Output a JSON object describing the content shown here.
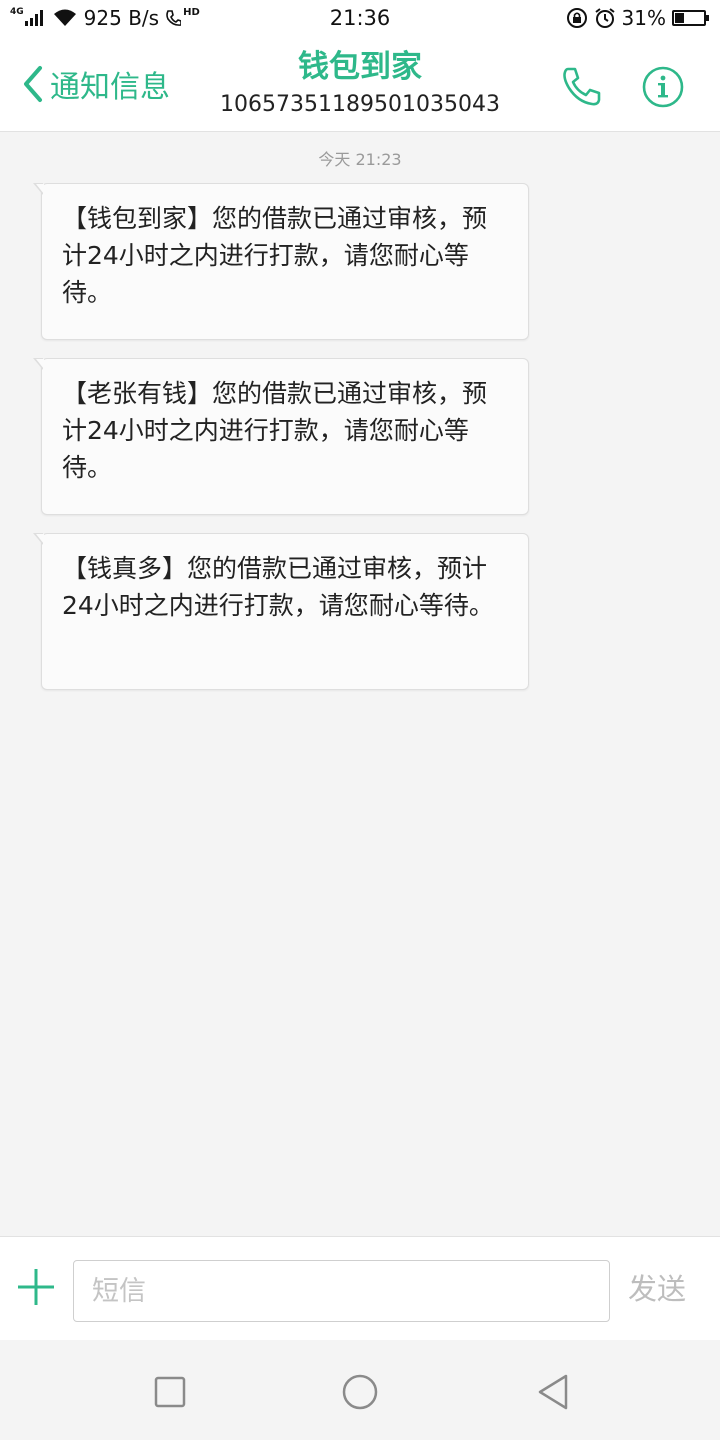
{
  "status_bar": {
    "network": "4G",
    "speed": "925 B/s",
    "hd": "HD",
    "time": "21:36",
    "battery_percent": "31%",
    "battery_level": 0.31
  },
  "header": {
    "back_label": "通知信息",
    "title": "钱包到家",
    "number": "10657351189501035043"
  },
  "conversation": {
    "timestamp": "今天 21:23",
    "messages": [
      "【钱包到家】您的借款已通过审核，预计24小时之内进行打款，请您耐心等待。",
      "【老张有钱】您的借款已通过审核，预计24小时之内进行打款，请您耐心等待。",
      "【钱真多】您的借款已通过审核，预计24小时之内进行打款，请您耐心等待。"
    ]
  },
  "composer": {
    "placeholder": "短信",
    "send_label": "发送"
  },
  "colors": {
    "accent": "#2eb88a",
    "background": "#f4f4f4",
    "bubble": "#fbfbfb"
  },
  "icons": {
    "signal": "signal-icon",
    "wifi": "wifi-icon",
    "call_hd": "hd-call-icon",
    "rotation_lock": "rotation-lock-icon",
    "alarm": "alarm-icon",
    "battery": "battery-icon",
    "back": "chevron-left-icon",
    "call": "phone-icon",
    "info": "info-icon",
    "add": "plus-icon",
    "nav_recent": "square-icon",
    "nav_home": "circle-icon",
    "nav_back": "triangle-back-icon"
  }
}
